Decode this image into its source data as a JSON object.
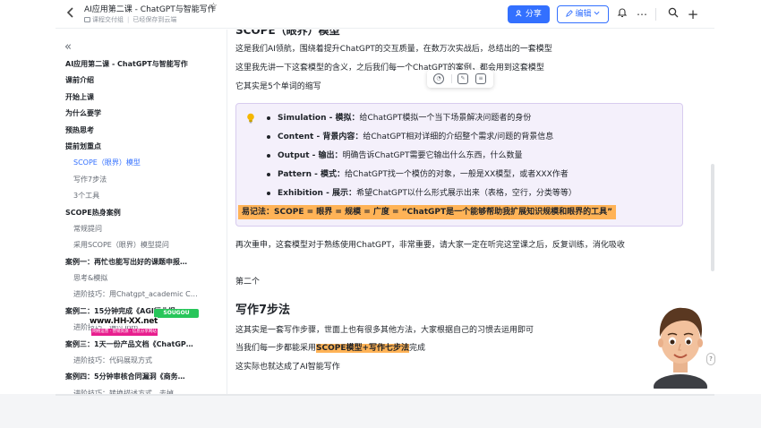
{
  "header": {
    "title": "AI应用第二课 - ChatGPT与智能写作",
    "meta_location": "课程交付组",
    "meta_status": "已经保存到云端",
    "share_label": "分享",
    "edit_label": "编辑"
  },
  "toc": [
    {
      "label": "AI应用第二课 - ChatGPT与智能写作",
      "level": 1
    },
    {
      "label": "课前介绍",
      "level": 1
    },
    {
      "label": "开始上课",
      "level": 1
    },
    {
      "label": "为什么要学",
      "level": 1
    },
    {
      "label": "预热思考",
      "level": 1
    },
    {
      "label": "提前划重点",
      "level": 1
    },
    {
      "label": "SCOPE（眼界）模型",
      "level": 2,
      "active": true
    },
    {
      "label": "写作7步法",
      "level": 2
    },
    {
      "label": "3个工具",
      "level": 2
    },
    {
      "label": "SCOPE热身案例",
      "level": 1
    },
    {
      "label": "常规提问",
      "level": 2
    },
    {
      "label": "采用SCOPE（眼界）模型提问",
      "level": 2
    },
    {
      "label": "案例一：再忙也能写出好的课题申报…",
      "level": 1
    },
    {
      "label": "思考&模拟",
      "level": 2
    },
    {
      "label": "进阶技巧：用Chatgpt_academic C…",
      "level": 2
    },
    {
      "label": "案例二：15分钟完成《AGI行业报…",
      "level": 1
    },
    {
      "label": "进阶技巧：通过Tom…",
      "level": 2
    },
    {
      "label": "案例三：1天一份产品文档《ChatGP…",
      "level": 1
    },
    {
      "label": "进阶技巧：代码展现方式",
      "level": 2
    },
    {
      "label": "案例四：5分钟审核合同漏洞《商务…",
      "level": 1
    },
    {
      "label": "进阶技巧：转换描述方式，去掉…",
      "level": 2
    }
  ],
  "watermark": {
    "top": "SOUGOU",
    "url": "www.HH-XX.net",
    "bar": "网络运营 · 营销资源 · 信息分享网站"
  },
  "content": {
    "cut_heading": "SCOPE（眼界）模型",
    "intro_1": "这是我们AI领航，围绕着提升ChatGPT的交互质量，在数万次实战后，总结出的一套模型",
    "intro_2": "这里我先讲一下这套模型的含义，之后我们每一个ChatGPT的案例，都会用到这套模型",
    "intro_3": "它其实是5个单词的缩写",
    "bullets": [
      {
        "key": "Simulation - 模拟：",
        "desc": "给ChatGPT模拟一个当下场景解决问题者的身份"
      },
      {
        "key": "Content - 背景内容：",
        "desc": "给ChatGPT相对详细的介绍整个需求/问题的背景信息"
      },
      {
        "key": "Output - 输出：",
        "desc": "明确告诉ChatGPT需要它输出什么东西，什么数量"
      },
      {
        "key": "Pattern - 模式：",
        "desc": "给ChatGPT找一个模仿的对象，一般是XX模型，或者XXX作者"
      },
      {
        "key": "Exhibition - 展示：",
        "desc": "希望ChatGPT以什么形式展示出来（表格，空行，分类等等）"
      }
    ],
    "memo": "易记法：SCOPE = 眼界 = 规模 = 广度 = “ChatGPT是一个能够帮助我扩展知识规模和眼界的工具”",
    "emphasis": "再次重申，这套模型对于熟练使用ChatGPT，非常重要，请大家一定在听完这堂课之后，反复训练，消化吸收",
    "second": "第二个",
    "h2": "写作7步法",
    "steps_1": "这其实是一套写作步骤，世面上也有很多其他方法，大家根据自己的习惯去运用即可",
    "steps_2_pre": "当我们每一步都能采用",
    "steps_2_hl": "SCOPE模型+写作七步法",
    "steps_2_post": "完成",
    "steps_3": "这实际也就达成了AI智能写作"
  },
  "colors": {
    "accent": "#3370ff",
    "callout_bg": "#f4f0fb",
    "highlight": "#ffb357"
  }
}
